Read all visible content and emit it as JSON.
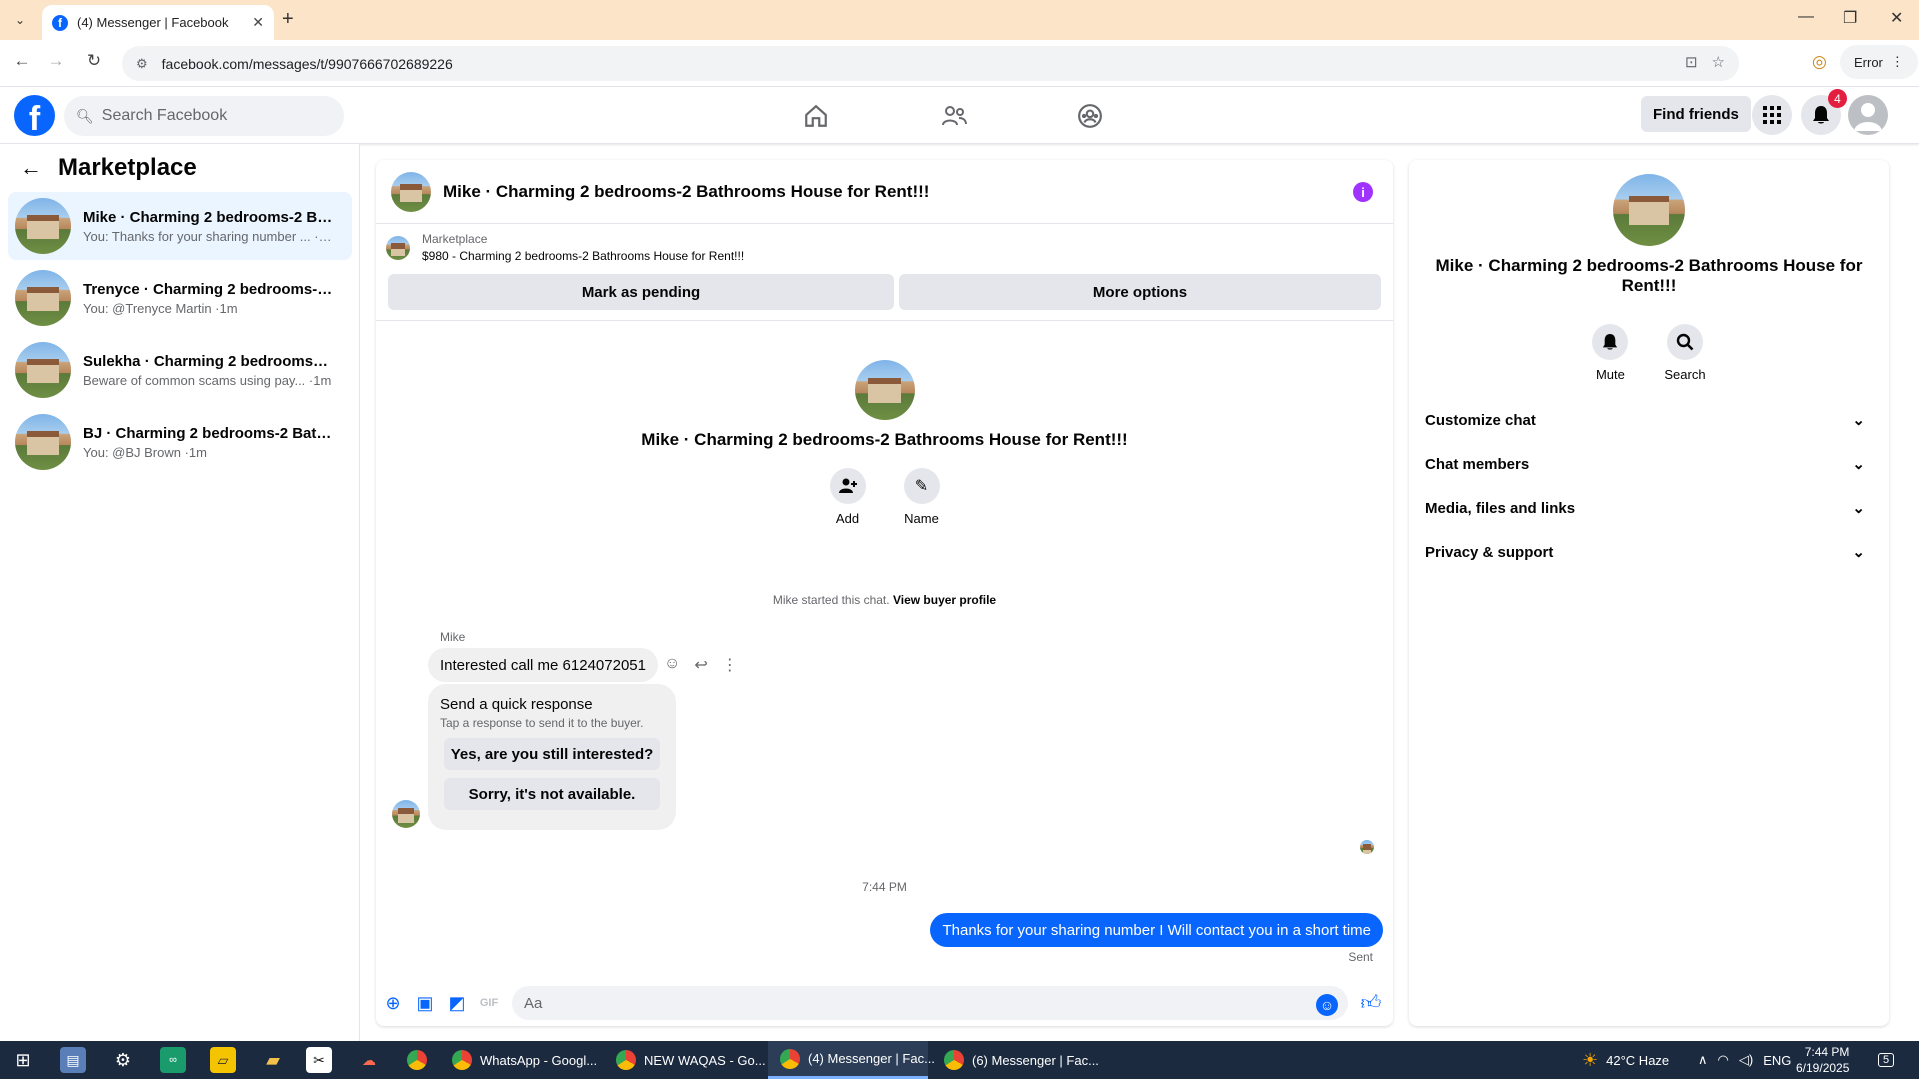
{
  "browser": {
    "tab_title": "(4) Messenger | Facebook",
    "url": "facebook.com/messages/t/9907666702689226",
    "profile_status": "Error"
  },
  "facebook": {
    "search_placeholder": "Search Facebook",
    "find_friends": "Find friends",
    "notifications_count": "4"
  },
  "marketplace": {
    "title": "Marketplace",
    "conversations": [
      {
        "name": "Mike · Charming 2 bedrooms-2 Ba...",
        "preview": "You: Thanks for your sharing number ... ·1m",
        "active": true
      },
      {
        "name": "Trenyce · Charming 2 bedrooms-2 ...",
        "preview": "You: @Trenyce Martin ·1m",
        "active": false
      },
      {
        "name": "Sulekha · Charming 2 bedrooms-2 ...",
        "preview": "Beware of common scams using pay... ·1m",
        "active": false
      },
      {
        "name": "BJ · Charming 2 bedrooms-2 Bathr...",
        "preview": "You: @BJ Brown ·1m",
        "active": false
      }
    ]
  },
  "chat": {
    "title": "Mike · Charming 2 bedrooms-2 Bathrooms House for Rent!!!",
    "marketplace_label": "Marketplace",
    "listing": "$980 - Charming 2 bedrooms-2 Bathrooms House for Rent!!!",
    "mark_pending": "Mark as pending",
    "more_options": "More options",
    "intro_title": "Mike · Charming 2 bedrooms-2 Bathrooms House for Rent!!!",
    "add_label": "Add",
    "name_label": "Name",
    "started_text": "Mike started this chat.",
    "view_buyer": "View buyer profile",
    "sender": "Mike",
    "incoming_message": "Interested call me 6124072051",
    "quick_title": "Send a quick response",
    "quick_sub": "Tap a response to send it to the buyer.",
    "quick_1": "Yes, are you still interested?",
    "quick_2": "Sorry, it's not available.",
    "timestamp": "7:44 PM",
    "outgoing_message": "Thanks for your sharing number I Will contact you in  a short time",
    "sent_label": "Sent",
    "composer_placeholder": "Aa"
  },
  "details": {
    "title": "Mike · Charming 2 bedrooms-2 Bathrooms House for Rent!!!",
    "mute": "Mute",
    "search": "Search",
    "sections": [
      "Customize chat",
      "Chat members",
      "Media, files and links",
      "Privacy & support"
    ]
  },
  "taskbar": {
    "apps": [
      {
        "label": "WhatsApp - Googl...",
        "active": false
      },
      {
        "label": "NEW WAQAS - Go...",
        "active": false
      },
      {
        "label": "(4) Messenger | Fac...",
        "active": true
      },
      {
        "label": "(6) Messenger | Fac...",
        "active": false
      }
    ],
    "weather": "42°C  Haze",
    "language": "ENG",
    "time": "7:44 PM",
    "date": "6/19/2025",
    "notif_count": "5"
  },
  "colors": {
    "accent": "#0866ff",
    "info": "#a033ff",
    "badge": "#e41e3f"
  }
}
